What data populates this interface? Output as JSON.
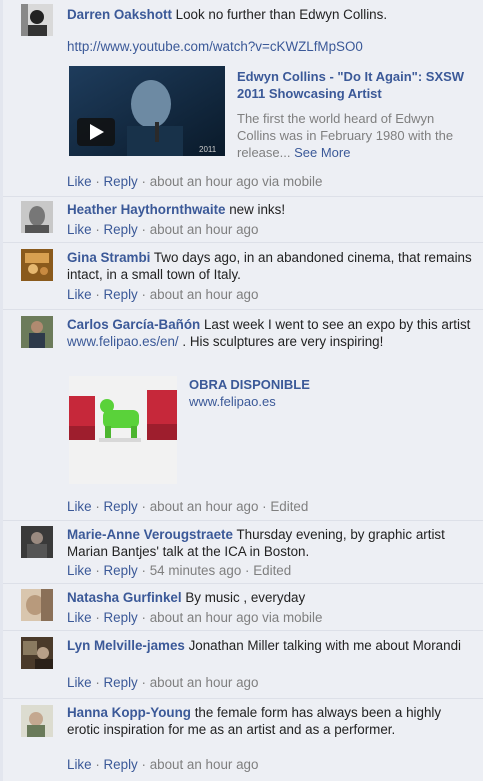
{
  "comments": [
    {
      "name": "Darren Oakshott",
      "text": "Look no further than Edwyn Collins.",
      "url": "http://www.youtube.com/watch?v=cKWZLfMpSO0",
      "preview": {
        "title": "Edwyn Collins - \"Do It Again\": SXSW 2011 Showcasing Artist",
        "description": "The first the world heard of Edwyn Collins was in February 1980 with the release...",
        "see_more": "See More",
        "thumb_caption": "2011"
      },
      "like": "Like",
      "reply": "Reply",
      "meta": "about an hour ago via mobile"
    },
    {
      "name": "Heather Haythornthwaite",
      "text": "new inks!",
      "like": "Like",
      "reply": "Reply",
      "meta": "about an hour ago"
    },
    {
      "name": "Gina Strambi",
      "text": "Two days ago, in an abandoned cinema, that remains intact, in a small town of Italy.",
      "like": "Like",
      "reply": "Reply",
      "meta": "about an hour ago"
    },
    {
      "name": "Carlos García-Bañón",
      "text_before": "Last week I went to see an expo by this artist",
      "link": "www.felipao.es/en/",
      "text_after": ". His sculptures are very inspiring!",
      "preview": {
        "title": "OBRA DISPONIBLE",
        "domain": "www.felipao.es"
      },
      "like": "Like",
      "reply": "Reply",
      "meta": "about an hour ago",
      "edited": "Edited"
    },
    {
      "name": "Marie-Anne Verougstraete",
      "text": "Thursday evening, by graphic artist Marian Bantjes' talk at the ICA in Boston.",
      "like": "Like",
      "reply": "Reply",
      "meta": "54 minutes ago",
      "edited": "Edited"
    },
    {
      "name": "Natasha Gurfinkel",
      "text": "By music , everyday",
      "like": "Like",
      "reply": "Reply",
      "meta": "about an hour ago via mobile"
    },
    {
      "name": "Lyn Melville-james",
      "text": "Jonathan Miller talking with me about Morandi",
      "like": "Like",
      "reply": "Reply",
      "meta": "about an hour ago"
    },
    {
      "name": "Hanna Kopp-Young",
      "text": "the female form has always been a highly erotic inspiration for me as an artist and as a performer.",
      "like": "Like",
      "reply": "Reply",
      "meta": "about an hour ago"
    }
  ],
  "separator": "·",
  "colors": {
    "link": "#3b5998",
    "meta": "#7f7f7f",
    "background": "#edeff4"
  }
}
